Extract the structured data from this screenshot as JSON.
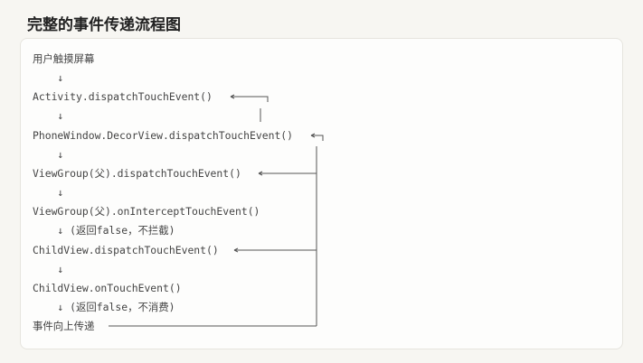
{
  "title": "完整的事件传递流程图",
  "flow": {
    "lines": [
      "用户触摸屏幕",
      "    ↓",
      "Activity.dispatchTouchEvent()",
      "    ↓",
      "PhoneWindow.DecorView.dispatchTouchEvent()",
      "    ↓",
      "ViewGroup(父).dispatchTouchEvent()",
      "    ↓",
      "ViewGroup(父).onInterceptTouchEvent()",
      "    ↓ (返回false，不拦截)",
      "ChildView.dispatchTouchEvent()",
      "    ↓",
      "ChildView.onTouchEvent()",
      "    ↓ (返回false，不消费)",
      "事件向上传递"
    ]
  }
}
